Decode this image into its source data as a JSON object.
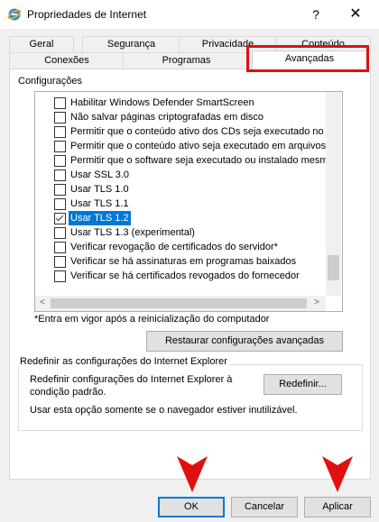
{
  "window": {
    "title": "Propriedades de Internet",
    "help_label": "?",
    "close_label": "✕"
  },
  "tabs": {
    "row1": [
      "Geral",
      "Segurança",
      "Privacidade",
      "Conteúdo"
    ],
    "row2": [
      "Conexões",
      "Programas",
      "Avançadas"
    ],
    "active": "Avançadas"
  },
  "settings": {
    "label": "Configurações",
    "items": [
      {
        "label": "Habilitar Windows Defender SmartScreen",
        "checked": false
      },
      {
        "label": "Não salvar páginas criptografadas em disco",
        "checked": false
      },
      {
        "label": "Permitir que o conteúdo ativo dos CDs seja executado no",
        "checked": false
      },
      {
        "label": "Permitir que o conteúdo ativo seja executado em arquivos",
        "checked": false
      },
      {
        "label": "Permitir que o software seja executado ou instalado mesm",
        "checked": false
      },
      {
        "label": "Usar SSL 3.0",
        "checked": false
      },
      {
        "label": "Usar TLS 1.0",
        "checked": false
      },
      {
        "label": "Usar TLS 1.1",
        "checked": false
      },
      {
        "label": "Usar TLS 1.2",
        "checked": true,
        "selected": true
      },
      {
        "label": "Usar TLS 1.3 (experimental)",
        "checked": false
      },
      {
        "label": "Verificar revogação de certificados do servidor*",
        "checked": false
      },
      {
        "label": "Verificar se há assinaturas em programas baixados",
        "checked": false
      },
      {
        "label": "Verificar se há certificados revogados do fornecedor",
        "checked": false
      }
    ],
    "note": "*Entra em vigor após a reinicialização do computador",
    "restore_button": "Restaurar configurações avançadas"
  },
  "reset_section": {
    "title": "Redefinir as configurações do Internet Explorer",
    "description_line1": "Redefinir configurações do Internet Explorer à",
    "description_line2": "condição padrão.",
    "reset_button": "Redefinir...",
    "note": "Usar esta opção somente se o navegador estiver inutilizável."
  },
  "footer": {
    "ok": "OK",
    "cancel": "Cancelar",
    "apply": "Aplicar"
  },
  "annotations": {
    "highlight_color": "#e01010"
  }
}
